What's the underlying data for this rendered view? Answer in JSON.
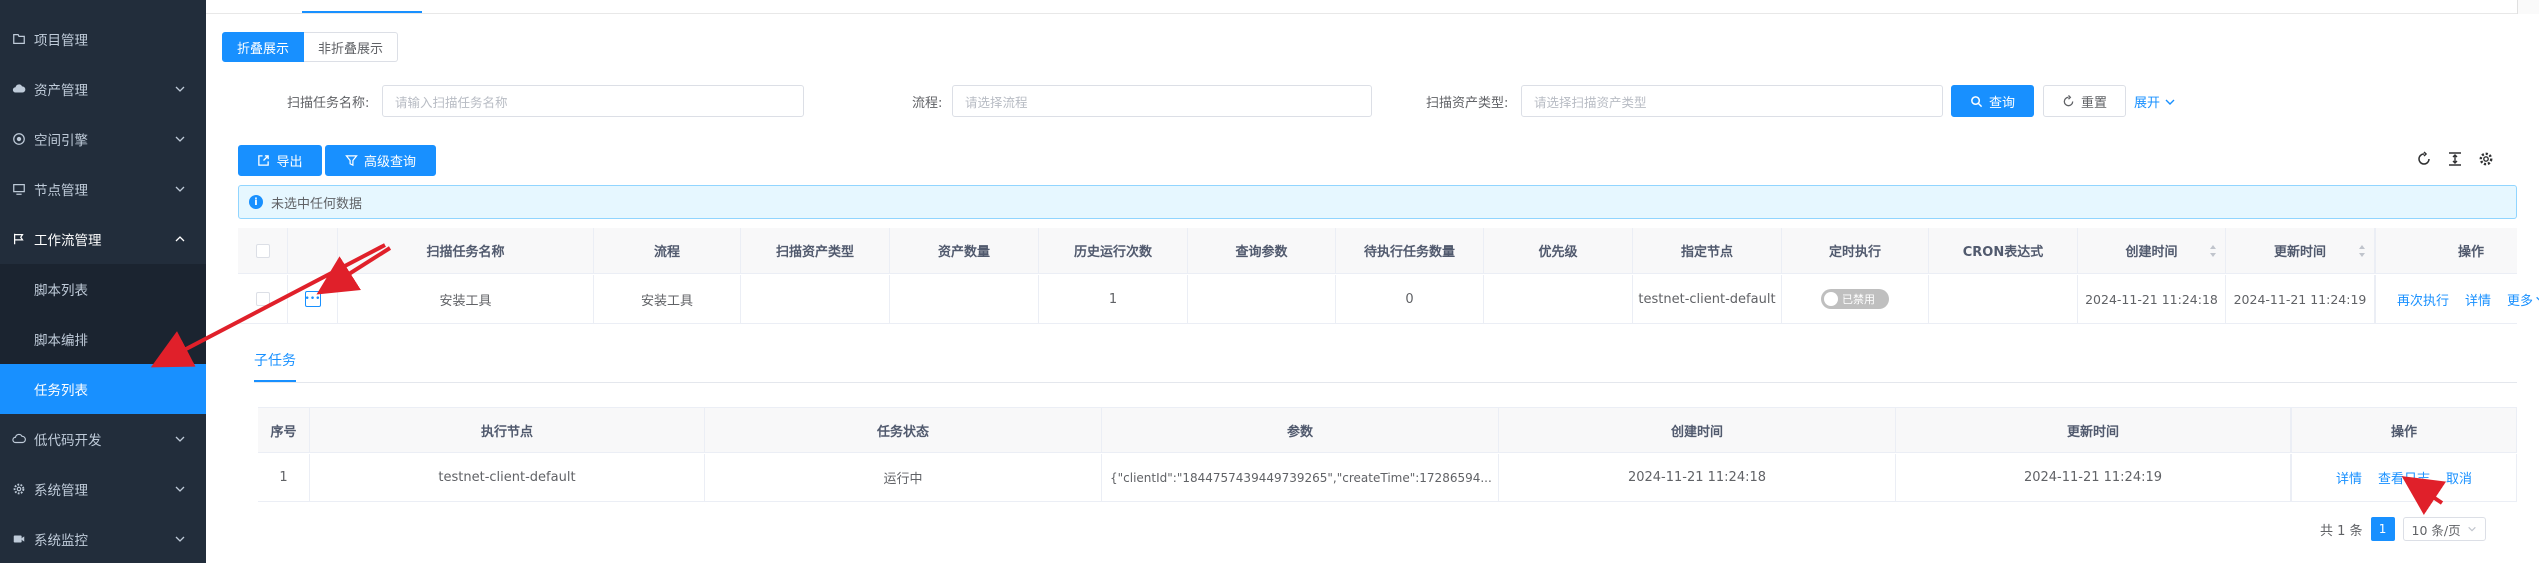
{
  "sidebar": {
    "items": [
      {
        "label": "项目管理",
        "icon": "folder-icon",
        "has_chevron": false
      },
      {
        "label": "资产管理",
        "icon": "cloud-icon",
        "has_chevron": true
      },
      {
        "label": "空间引擎",
        "icon": "globe-icon",
        "has_chevron": true
      },
      {
        "label": "节点管理",
        "icon": "monitor-icon",
        "has_chevron": true
      },
      {
        "label": "工作流管理",
        "icon": "flag-icon",
        "has_chevron": true
      },
      {
        "label": "低代码开发",
        "icon": "cloud-icon",
        "has_chevron": true
      },
      {
        "label": "系统管理",
        "icon": "gear-icon",
        "has_chevron": true
      },
      {
        "label": "系统监控",
        "icon": "video-icon",
        "has_chevron": true
      }
    ],
    "subitems": [
      {
        "label": "脚本列表"
      },
      {
        "label": "脚本编排"
      },
      {
        "label": "任务列表"
      }
    ]
  },
  "view_mode": {
    "folded": "折叠展示",
    "unfolded": "非折叠展示"
  },
  "filters": {
    "task_name_label": "扫描任务名称:",
    "task_name_placeholder": "请输入扫描任务名称",
    "flow_label": "流程:",
    "flow_placeholder": "请选择流程",
    "asset_type_label": "扫描资产类型:",
    "asset_type_placeholder": "请选择扫描资产类型",
    "search_label": "查询",
    "reset_label": "重置",
    "expand_label": "展开"
  },
  "toolbar": {
    "export_label": "导出",
    "advanced_label": "高级查询"
  },
  "selection_info": "未选中任何数据",
  "table": {
    "columns": [
      "扫描任务名称",
      "流程",
      "扫描资产类型",
      "资产数量",
      "历史运行次数",
      "查询参数",
      "待执行任务数量",
      "优先级",
      "指定节点",
      "定时执行",
      "CRON表达式",
      "创建时间",
      "更新时间",
      "操作"
    ],
    "rows": [
      {
        "name": "安装工具",
        "flow": "安装工具",
        "asset_type": "",
        "asset_count": "",
        "run_count": "1",
        "query_params": "",
        "pending": "0",
        "priority": "",
        "node": "testnet-client-default",
        "schedule": "已禁用",
        "cron": "",
        "created": "2024-11-21 11:24:18",
        "updated": "2024-11-21 11:24:19",
        "ops": [
          "再次执行",
          "详情",
          "更多"
        ]
      }
    ]
  },
  "subtask": {
    "tab_label": "子任务",
    "columns": [
      "序号",
      "执行节点",
      "任务状态",
      "参数",
      "创建时间",
      "更新时间",
      "操作"
    ],
    "rows": [
      {
        "index": "1",
        "node": "testnet-client-default",
        "status": "运行中",
        "params": "{\"clientId\":\"1844757439449739265\",\"createTime\":17286594...",
        "created": "2024-11-21 11:24:18",
        "updated": "2024-11-21 11:24:19",
        "ops": [
          "详情",
          "查看日志",
          "取消"
        ]
      }
    ],
    "total": "共 1 条",
    "page": "1",
    "page_size": "10 条/页"
  },
  "colors": {
    "primary": "#1890ff",
    "sidebar_bg": "#222d3b",
    "annotation_arrow": "#e0202a"
  }
}
